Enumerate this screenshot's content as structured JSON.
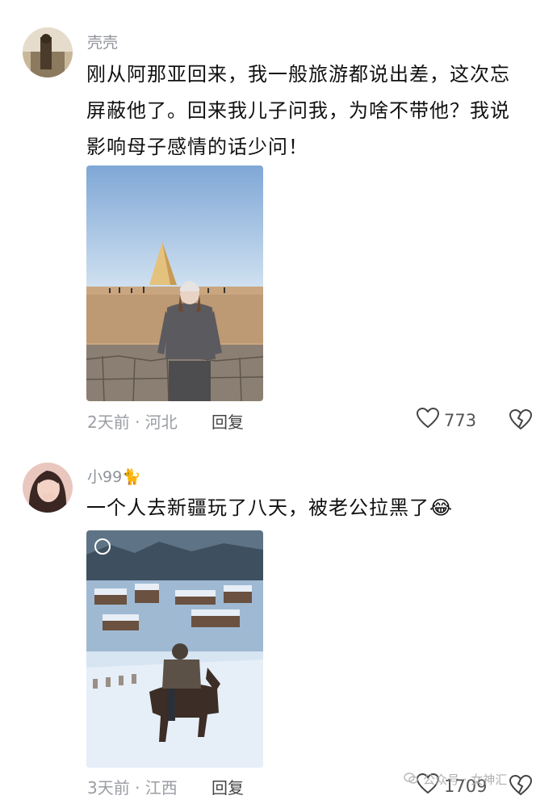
{
  "comments": [
    {
      "username": "壳壳",
      "lines": [
        "刚从阿那亚回来，我一般旅游都说出差，这次忘",
        "屏蔽他了。回来我儿子问我，为啥不带他？我说",
        "影响母子感情的话少问！"
      ],
      "meta": "2天前 · 河北",
      "reply": "回复",
      "likes": "773"
    },
    {
      "username": "小99",
      "username_emoji": "🐈",
      "text": "一个人去新疆玩了八天，被老公拉黑了",
      "text_emoji": "😂",
      "meta": "3天前 · 江西",
      "reply": "回复",
      "likes": "1709"
    }
  ],
  "watermark": "公众号 · 女神汇",
  "colors": {
    "meta": "#9a9da3",
    "username": "#8f9399",
    "text": "#111111"
  }
}
